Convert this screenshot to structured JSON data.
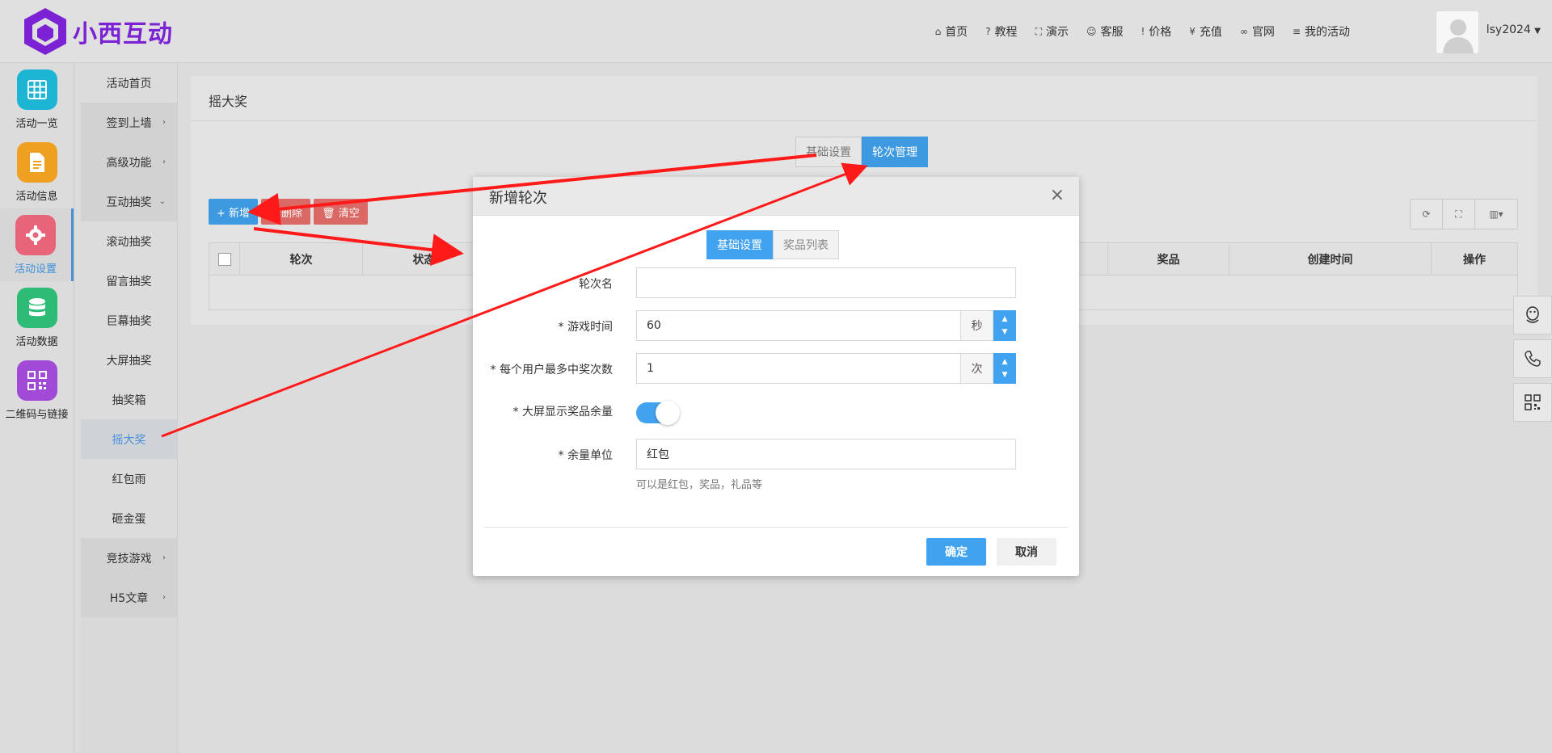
{
  "header": {
    "brand": "小西互动",
    "nav": [
      {
        "icon": "home-icon",
        "glyph": "⌂",
        "label": "首页"
      },
      {
        "icon": "help-icon",
        "glyph": "?",
        "label": "教程"
      },
      {
        "icon": "demo-icon",
        "glyph": "⛶",
        "label": "演示"
      },
      {
        "icon": "service-icon",
        "glyph": "☺",
        "label": "客服"
      },
      {
        "icon": "price-icon",
        "glyph": "!",
        "label": "价格"
      },
      {
        "icon": "yen-icon",
        "glyph": "¥",
        "label": "充值"
      },
      {
        "icon": "link-icon",
        "glyph": "∞",
        "label": "官网"
      },
      {
        "icon": "list-icon",
        "glyph": "≡",
        "label": "我的活动"
      }
    ],
    "username": "lsy2024"
  },
  "icon_sidebar": [
    {
      "label": "活动一览",
      "color": "#1cb6d4",
      "icon": "grid-icon"
    },
    {
      "label": "活动信息",
      "color": "#f0a020",
      "icon": "document-icon"
    },
    {
      "label": "活动设置",
      "color": "#e86478",
      "icon": "gear-icon",
      "active": true
    },
    {
      "label": "活动数据",
      "color": "#2dbb75",
      "icon": "database-icon"
    },
    {
      "label": "二维码与链接",
      "color": "#a24ad8",
      "icon": "qrcode-icon"
    }
  ],
  "sub_sidebar": [
    {
      "label": "活动首页"
    },
    {
      "label": "签到上墙",
      "chev": "›"
    },
    {
      "label": "高级功能",
      "chev": "›"
    },
    {
      "label": "互动抽奖",
      "chev": "⌄"
    },
    {
      "label": "滚动抽奖"
    },
    {
      "label": "留言抽奖"
    },
    {
      "label": "巨幕抽奖"
    },
    {
      "label": "大屏抽奖"
    },
    {
      "label": "抽奖箱"
    },
    {
      "label": "摇大奖",
      "active": true
    },
    {
      "label": "红包雨"
    },
    {
      "label": "砸金蛋"
    },
    {
      "label": "竞技游戏",
      "chev": "›"
    },
    {
      "label": "H5文章",
      "chev": "›"
    }
  ],
  "panel": {
    "title": "摇大奖",
    "tabs": [
      "基础设置",
      "轮次管理"
    ],
    "toolbar": {
      "add": "+ 新增",
      "delete": "✕ 删除",
      "clear": "🗑 清空"
    },
    "tools": [
      "⟳",
      "⛶",
      "▥▾"
    ],
    "columns": [
      "",
      "轮次",
      "状态",
      "",
      "奖品",
      "创建时间",
      "操作"
    ]
  },
  "dialog": {
    "title": "新增轮次",
    "tabs": [
      "基础设置",
      "奖品列表"
    ],
    "round_name_label": "轮次名",
    "round_name_value": "",
    "game_time_label": "* 游戏时间",
    "game_time_value": "60",
    "game_time_unit": "秒",
    "max_win_label": "* 每个用户最多中奖次数",
    "max_win_value": "1",
    "max_win_unit": "次",
    "show_remaining_label": "* 大屏显示奖品余量",
    "show_remaining_on": true,
    "unit_label": "* 余量单位",
    "unit_value": "红包",
    "unit_hint": "可以是红包，奖品，礼品等",
    "confirm": "确定",
    "cancel": "取消"
  },
  "float_tools": [
    "qq-icon",
    "phone-icon",
    "qrcode-icon"
  ]
}
